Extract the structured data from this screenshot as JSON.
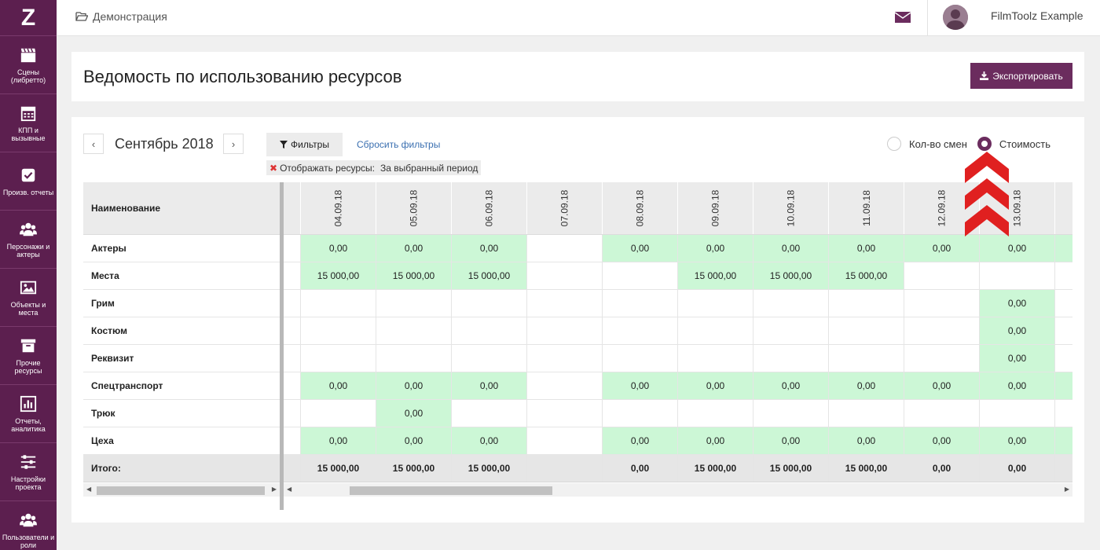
{
  "sidebar": {
    "logo": "Z",
    "items": [
      {
        "label": "Сцены (либретто)",
        "icon": "clapperboard-icon"
      },
      {
        "label": "КПП и вызывные",
        "icon": "calendar-icon"
      },
      {
        "label": "Произв. отчеты",
        "icon": "checkbox-icon"
      },
      {
        "label": "Персонажи и актеры",
        "icon": "users-icon"
      },
      {
        "label": "Объекты и места",
        "icon": "image-icon"
      },
      {
        "label": "Прочие ресурсы",
        "icon": "archive-icon"
      },
      {
        "label": "Отчеты, аналитика",
        "icon": "chart-icon"
      },
      {
        "label": "Настройки проекта",
        "icon": "sliders-icon"
      },
      {
        "label": "Пользователи и роли",
        "icon": "users-icon"
      }
    ]
  },
  "header": {
    "breadcrumb": "Демонстрация",
    "user_name": "FilmToolz Example"
  },
  "page": {
    "title": "Ведомость по использованию ресурсов",
    "export_label": "Экспортировать"
  },
  "controls": {
    "prev": "‹",
    "next": "›",
    "month": "Сентябрь 2018",
    "filters_label": "Фильтры",
    "reset_label": "Сбросить фильтры",
    "filter_tag_key": "Отображать ресурсы:",
    "filter_tag_value": "За выбранный период",
    "radio_shifts": "Кол-во смен",
    "radio_cost": "Стоимость",
    "selected_mode": "Стоимость"
  },
  "table": {
    "name_header": "Наименование",
    "dates": [
      "04.09.18",
      "05.09.18",
      "06.09.18",
      "07.09.18",
      "08.09.18",
      "09.09.18",
      "10.09.18",
      "11.09.18",
      "12.09.18",
      "13.09.18"
    ],
    "rows": [
      {
        "name": "Актеры",
        "cells": [
          "0,00",
          "0,00",
          "0,00",
          "",
          "0,00",
          "0,00",
          "0,00",
          "0,00",
          "0,00",
          "0,00"
        ],
        "trailing_green": true
      },
      {
        "name": "Места",
        "cells": [
          "15 000,00",
          "15 000,00",
          "15 000,00",
          "",
          "",
          "15 000,00",
          "15 000,00",
          "15 000,00",
          "",
          ""
        ],
        "trailing_green": false
      },
      {
        "name": "Грим",
        "cells": [
          "",
          "",
          "",
          "",
          "",
          "",
          "",
          "",
          "",
          "0,00"
        ],
        "trailing_green": false
      },
      {
        "name": "Костюм",
        "cells": [
          "",
          "",
          "",
          "",
          "",
          "",
          "",
          "",
          "",
          "0,00"
        ],
        "trailing_green": false
      },
      {
        "name": "Реквизит",
        "cells": [
          "",
          "",
          "",
          "",
          "",
          "",
          "",
          "",
          "",
          "0,00"
        ],
        "trailing_green": false
      },
      {
        "name": "Спецтранспорт",
        "cells": [
          "0,00",
          "0,00",
          "0,00",
          "",
          "0,00",
          "0,00",
          "0,00",
          "0,00",
          "0,00",
          "0,00"
        ],
        "trailing_green": true
      },
      {
        "name": "Трюк",
        "cells": [
          "",
          "0,00",
          "",
          "",
          "",
          "",
          "",
          "",
          "",
          ""
        ],
        "trailing_green": false
      },
      {
        "name": "Цеха",
        "cells": [
          "0,00",
          "0,00",
          "0,00",
          "",
          "0,00",
          "0,00",
          "0,00",
          "0,00",
          "0,00",
          "0,00"
        ],
        "trailing_green": true
      }
    ],
    "total_label": "Итого:",
    "totals": [
      "15 000,00",
      "15 000,00",
      "15 000,00",
      "",
      "0,00",
      "15 000,00",
      "15 000,00",
      "15 000,00",
      "0,00",
      "0,00"
    ]
  }
}
